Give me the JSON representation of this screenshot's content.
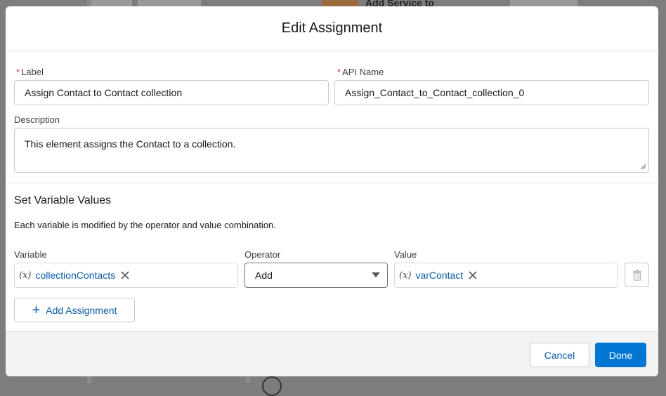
{
  "background": {
    "node_label": "Add Service to"
  },
  "modal": {
    "title": "Edit Assignment",
    "label_field": {
      "label": "Label",
      "required_mark": "*",
      "value": "Assign Contact to Contact collection"
    },
    "api_name_field": {
      "label": "API Name",
      "required_mark": "*",
      "value": "Assign_Contact_to_Contact_collection_0"
    },
    "description_field": {
      "label": "Description",
      "value": "This element assigns the Contact to a collection."
    },
    "variables_section": {
      "title": "Set Variable Values",
      "helper": "Each variable is modified by the operator and value combination.",
      "columns": {
        "variable": "Variable",
        "operator": "Operator",
        "value": "Value"
      },
      "row": {
        "variable_icon": "(x)",
        "variable": "collectionContacts",
        "operator": "Add",
        "value_icon": "(x)",
        "value": "varContact"
      },
      "add_button": "Add Assignment"
    },
    "footer": {
      "cancel": "Cancel",
      "done": "Done"
    }
  },
  "colors": {
    "brand": "#0176d3",
    "link": "#0b5cab",
    "required": "#c23934"
  }
}
